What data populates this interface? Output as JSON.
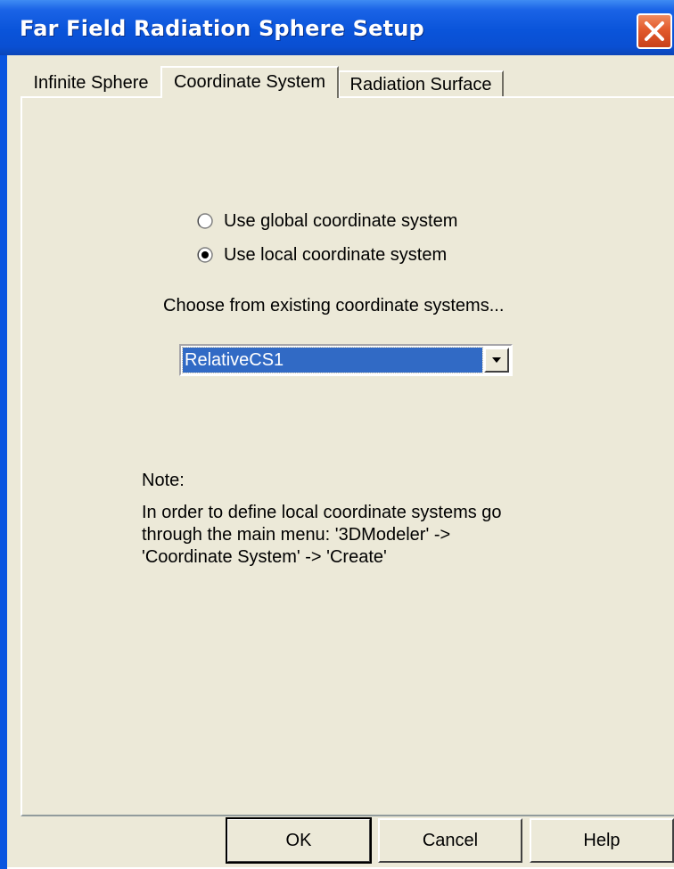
{
  "window": {
    "title": "Far Field Radiation Sphere Setup"
  },
  "titlebar": {
    "close_icon": "close-icon"
  },
  "tabs": [
    {
      "label": "Infinite Sphere",
      "selected": false
    },
    {
      "label": "Coordinate System",
      "selected": true
    },
    {
      "label": "Radiation Surface",
      "selected": false
    }
  ],
  "coordinate_system": {
    "options": [
      {
        "label": "Use global coordinate system",
        "checked": false
      },
      {
        "label": "Use local coordinate system",
        "checked": true
      }
    ],
    "choose_label": "Choose from existing coordinate systems...",
    "selected_system": "RelativeCS1"
  },
  "note": {
    "heading": "Note:",
    "lines": [
      "In order to define local coordinate systems go",
      "through the main menu: '3DModeler' ->",
      "'Coordinate System' -> 'Create'"
    ]
  },
  "buttons": {
    "ok": "OK",
    "cancel": "Cancel",
    "help": "Help"
  },
  "colors": {
    "titlebar": "#0a54da",
    "dialog_background": "#ece9d8",
    "selection": "#316ac5",
    "close_button": "#e25a2c"
  }
}
